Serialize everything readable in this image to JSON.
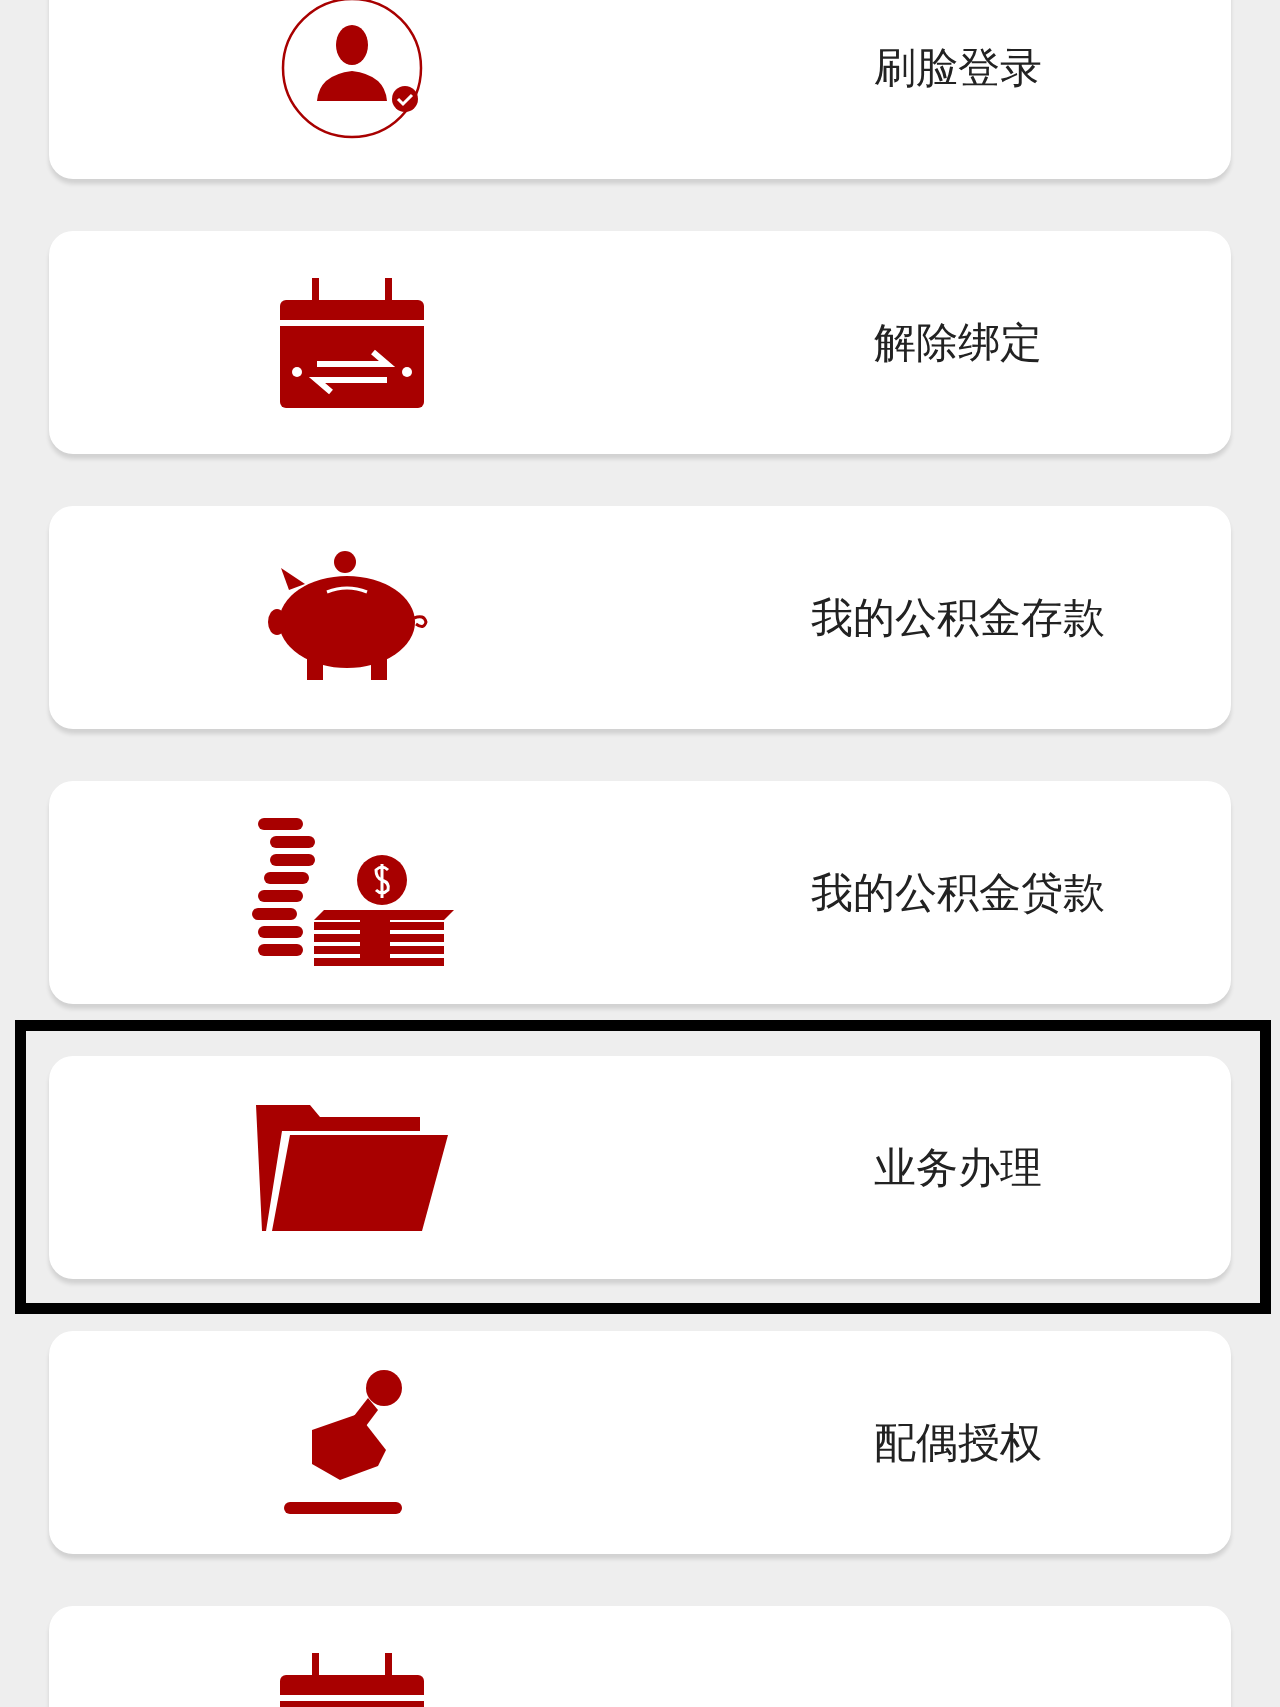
{
  "items": [
    {
      "kind": "face",
      "label": "刷脸登录",
      "selected": false
    },
    {
      "kind": "unbind",
      "label": "解除绑定",
      "selected": false
    },
    {
      "kind": "savings",
      "label": "我的公积金存款",
      "selected": false
    },
    {
      "kind": "loan",
      "label": "我的公积金贷款",
      "selected": false
    },
    {
      "kind": "folder",
      "label": "业务办理",
      "selected": true
    },
    {
      "kind": "stamp",
      "label": "配偶授权",
      "selected": false
    },
    {
      "kind": "calendar",
      "selected": false
    }
  ]
}
